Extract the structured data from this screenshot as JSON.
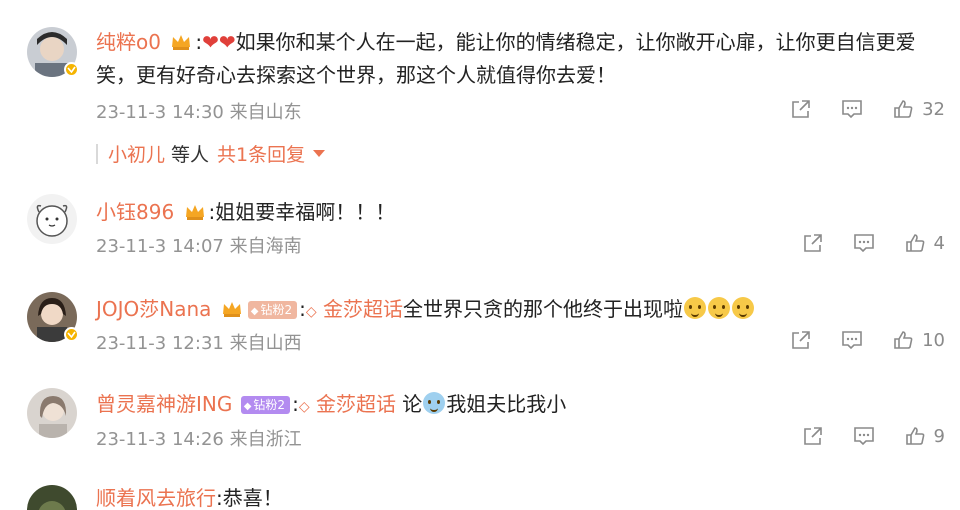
{
  "comments": [
    {
      "username": "纯粹o0",
      "separator": ":",
      "text_line1": "如果你和某个人在一起，能让你的情绪稳定，让你敞开心扉，让你更自信更爱",
      "text_line2": "笑，更有好奇心去探索这个世界，那这个人就值得你去爱！",
      "time_location": "23-11-3 14:30 来自山东",
      "likes": "32"
    },
    {
      "username": "小钰896",
      "separator": ":",
      "text": "姐姐要幸福啊！！！",
      "time_location": "23-11-3 14:07 来自海南",
      "likes": "4"
    },
    {
      "username": "JOJO莎Nana",
      "fan_badge": "钻粉2",
      "separator": ":",
      "topic": "金莎超话",
      "text": "全世界只贪的那个他终于出现啦",
      "time_location": "23-11-3 12:31 来自山西",
      "likes": "10"
    },
    {
      "username": "曾灵嘉神游ING",
      "fan_badge": "钻粉2",
      "separator": ":",
      "topic": "金莎超话",
      "text_prefix": " 论",
      "text": "我姐夫比我小",
      "time_location": "23-11-3 14:26 来自浙江",
      "likes": "9"
    },
    {
      "username": "顺着风去旅行",
      "separator": ":",
      "text": "恭喜！"
    }
  ],
  "reply_summary": {
    "names": "小初儿",
    "etc": "等人",
    "link": "共1条回复"
  },
  "colors": {
    "username": "#eb7350",
    "meta": "#939393",
    "icon": "#8a8a8a"
  },
  "icons": [
    "share-icon",
    "comment-icon",
    "like-icon",
    "vip-crown-icon",
    "verified-badge-icon",
    "diamond-icon",
    "heart-icon",
    "emoji-icon",
    "caret-down-icon"
  ]
}
